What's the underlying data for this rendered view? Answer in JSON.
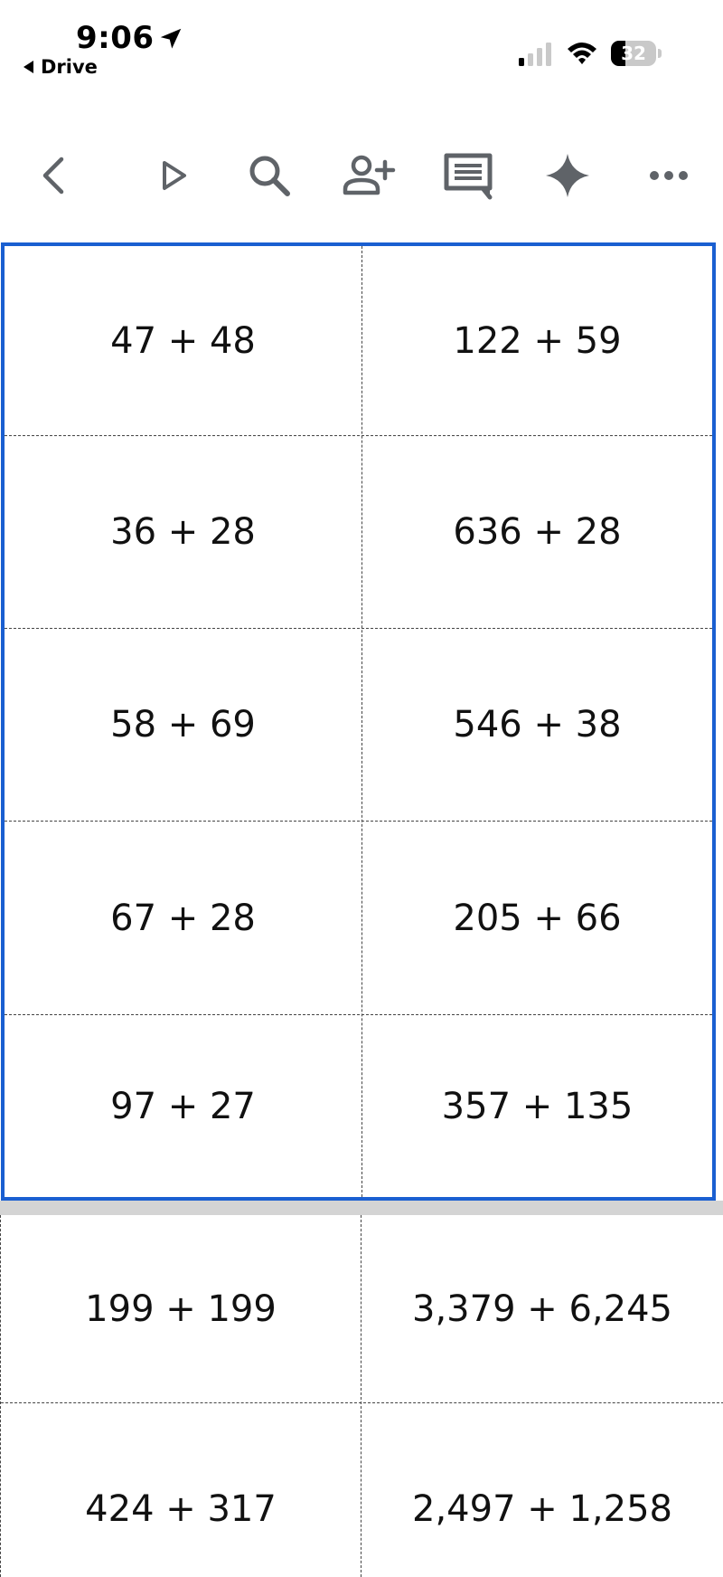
{
  "status_bar": {
    "time": "9:06",
    "back_label": "Drive",
    "battery": "32",
    "battery_level": 0.32
  },
  "toolbar": {
    "icons": [
      "back-chevron-icon",
      "play-icon",
      "search-icon",
      "add-person-icon",
      "comment-icon",
      "sparkle-icon",
      "more-icon"
    ],
    "icon_color": "#5f6368"
  },
  "document": {
    "selection_color": "#1a5fd1",
    "selected_table": {
      "rows": [
        [
          "47 + 48",
          "122 + 59"
        ],
        [
          "36 + 28",
          "636 + 28"
        ],
        [
          "58 + 69",
          "546 + 38"
        ],
        [
          "67 + 28",
          "205 + 66"
        ],
        [
          "97 + 27",
          "357 + 135"
        ]
      ]
    },
    "next_table": {
      "rows": [
        [
          "199 + 199",
          "3,379 + 6,245"
        ],
        [
          "424 + 317",
          "2,497 + 1,258"
        ]
      ]
    }
  }
}
